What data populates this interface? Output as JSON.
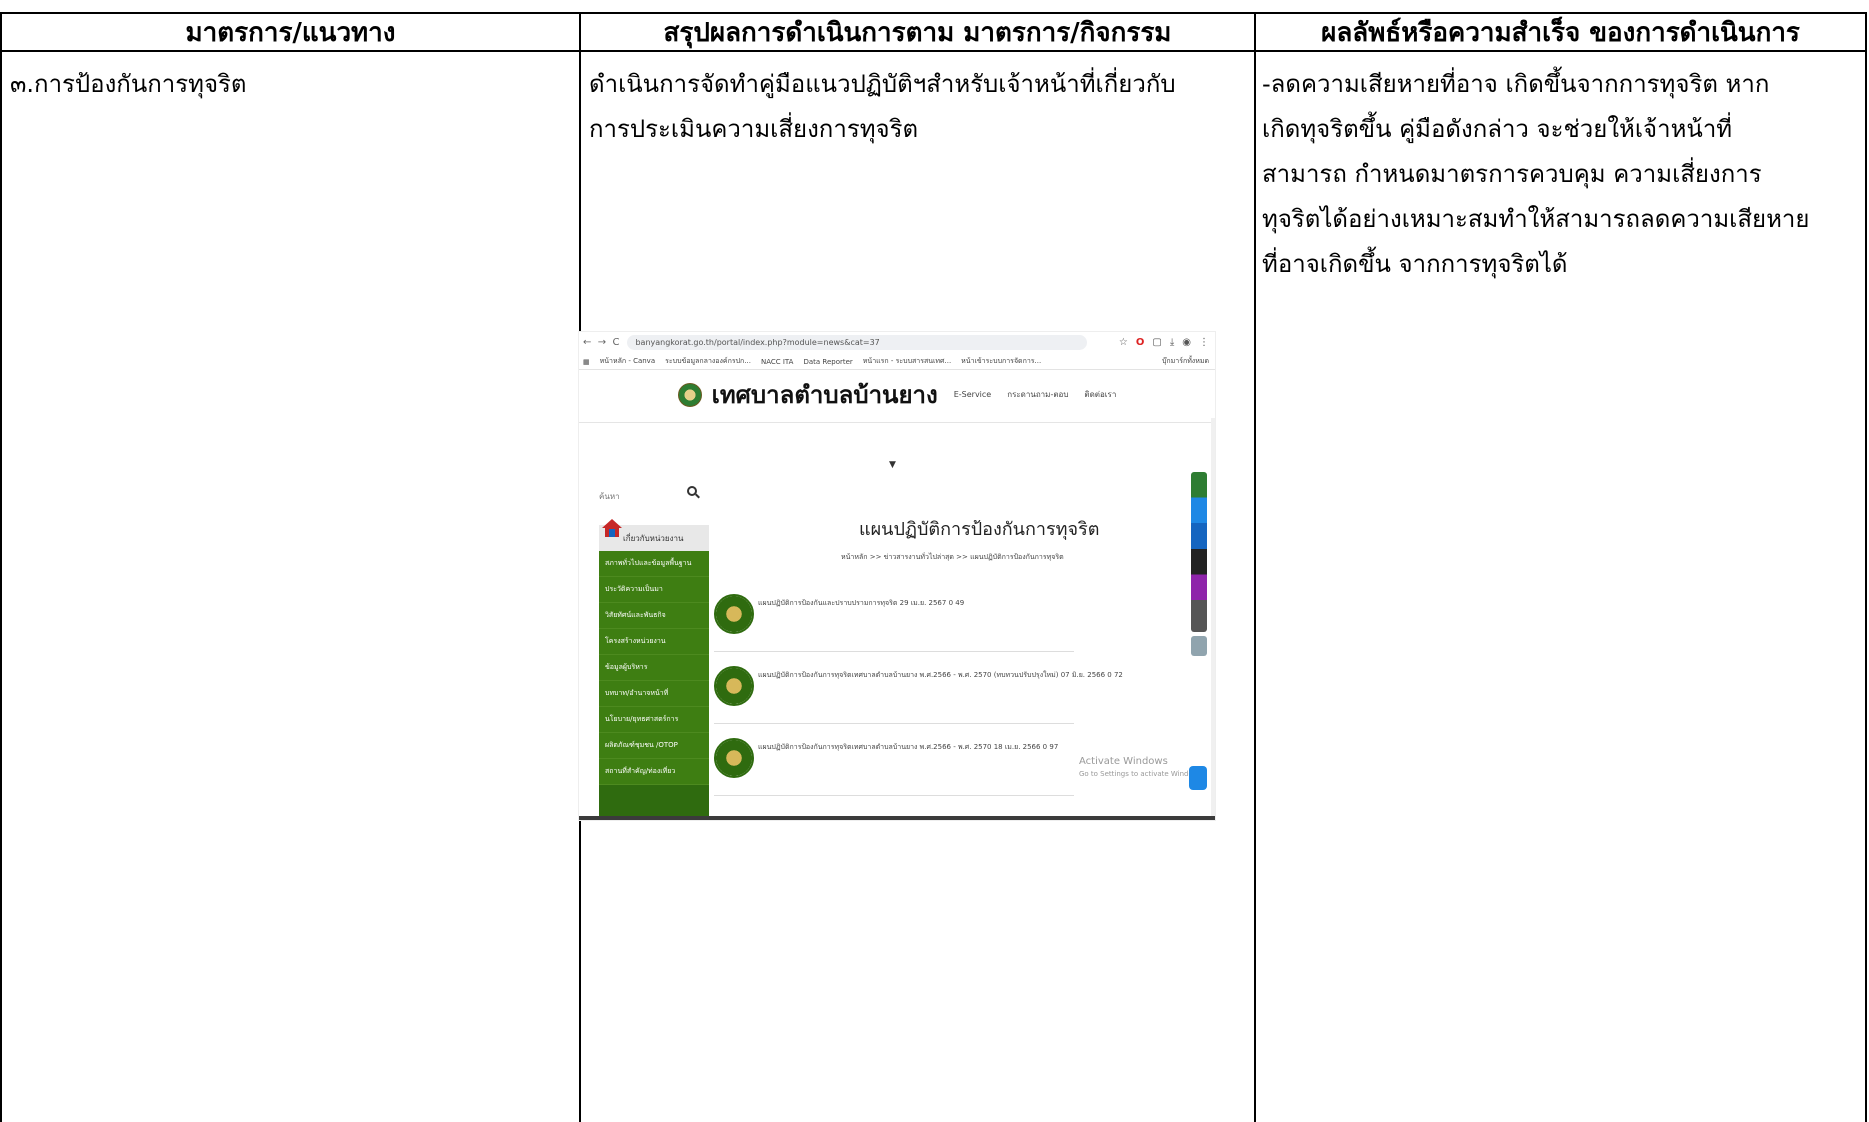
{
  "table": {
    "headers": [
      "มาตรการ/แนวทาง",
      "สรุปผลการดำเนินการตาม มาตรการ/กิจกรรม",
      "ผลลัพธ์หรือความสำเร็จ ของการดำเนินการ"
    ],
    "row": {
      "measure": "๓.การป้องกันการทุจริต",
      "summary": "ดำเนินการจัดทำคู่มือแนวปฏิบัติฯสำหรับเจ้าหน้าที่เกี่ยวกับ\nการประเมินความเสี่ยงการทุจริต",
      "result": "-ลดความเสียหายที่อาจ เกิดขึ้นจากการทุจริต หาก\nเกิดทุจริตขึ้น คู่มือดังกล่าว จะช่วยให้เจ้าหน้าที่\nสามารถ กำหนดมาตรการควบคุม ความเสี่ยงการ\nทุจริตได้อย่างเหมาะสมทำให้สามารถลดความเสียหาย\nที่อาจเกิดขึ้น จากการทุจริตได้"
    }
  },
  "screenshot": {
    "url": "banyangkorat.go.th/portal/index.php?module=news&cat=37",
    "bookmarks": [
      "หน้าหลัก - Canva",
      "ระบบข้อมูลกลางองค์กรปก...",
      "NACC ITA",
      "Data Reporter",
      "หน้าแรก - ระบบสารสนเทศ...",
      "หน้าเข้าระบบการจัดการ..."
    ],
    "bookmarks_right": "บุ๊กมาร์กทั้งหมด",
    "site_title": "เทศบาลตำบลบ้านยาง",
    "menu": [
      "E-Service",
      "กระดานถาม-ตอบ",
      "ติดต่อเรา"
    ],
    "search_placeholder": "ค้นหา",
    "sidebar_head": "เกี่ยวกับหน่วยงาน",
    "sidebar_items": [
      "สภาพทั่วไปและข้อมูลพื้นฐาน",
      "ประวัติความเป็นมา",
      "วิสัยทัศน์และพันธกิจ",
      "โครงสร้างหน่วยงาน",
      "ข้อมูลผู้บริหาร",
      "บทบาท/อำนาจหน้าที่",
      "นโยบาย/ยุทธศาสตร์การ",
      "ผลิตภัณฑ์ชุมชน /OTOP",
      "สถานที่สำคัญ/ท่องเที่ยว"
    ],
    "page_heading": "แผนปฏิบัติการป้องกันการทุจริต",
    "breadcrumb": "หน้าหลัก >> ข่าวสารงานทั่วไปล่าสุด >> แผนปฏิบัติการป้องกันการทุจริต",
    "posts": [
      "แผนปฏิบัติการป้องกันและปราบปรามการทุจริต 29 เม.ย. 2567  0  49",
      "แผนปฏิบัติการป้องกันการทุจริตเทศบาลตำบลบ้านยาง พ.ศ.2566 - พ.ศ. 2570 (ทบทวนปรับปรุงใหม่) 07 มิ.ย. 2566  0  72",
      "แผนปฏิบัติการป้องกันการทุจริตเทศบาลตำบลบ้านยาง พ.ศ.2566 - พ.ศ. 2570 18 เม.ย. 2566  0  97"
    ],
    "activate_title": "Activate Windows",
    "activate_sub": "Go to Settings to activate Windows."
  }
}
